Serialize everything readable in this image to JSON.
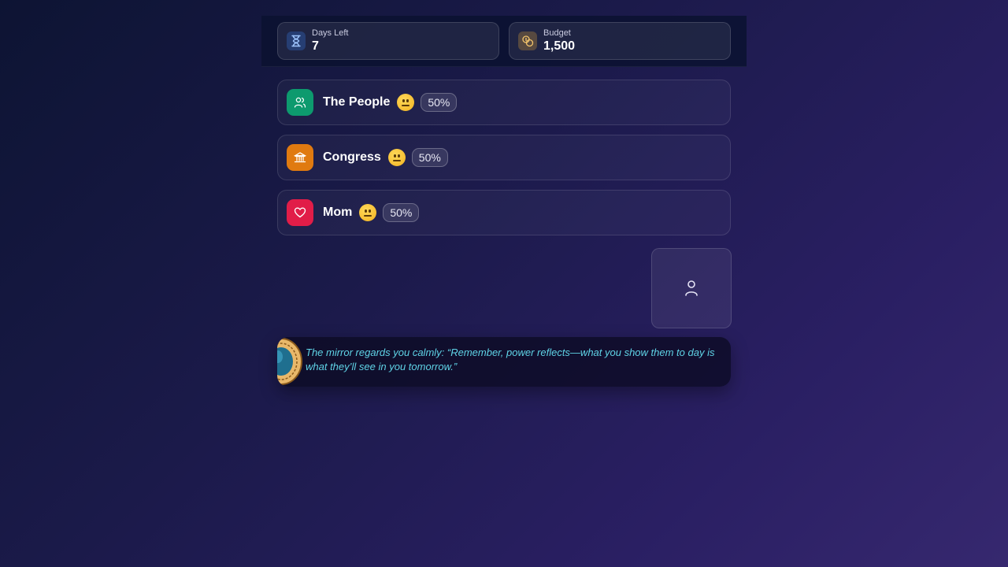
{
  "stats": {
    "days_left": {
      "label": "Days Left",
      "value": "7",
      "icon": "hourglass-icon"
    },
    "budget": {
      "label": "Budget",
      "value": "1,500",
      "icon": "coins-icon"
    }
  },
  "factions": [
    {
      "name": "The People",
      "approval": "50%",
      "mood": "neutral-face-emoji",
      "icon": "people-icon",
      "color": "#0d9a6e"
    },
    {
      "name": "Congress",
      "approval": "50%",
      "mood": "neutral-face-emoji",
      "icon": "capitol-icon",
      "color": "#e07a10"
    },
    {
      "name": "Mom",
      "approval": "50%",
      "mood": "neutral-face-emoji",
      "icon": "heart-icon",
      "color": "#e11d48"
    }
  ],
  "player": {
    "icon": "user-icon"
  },
  "mirror": {
    "icon": "magic-mirror-icon",
    "message": "The mirror regards you calmly: “Remember, power reflects—what you show them to day is what they’ll see in you tomorrow.”"
  }
}
